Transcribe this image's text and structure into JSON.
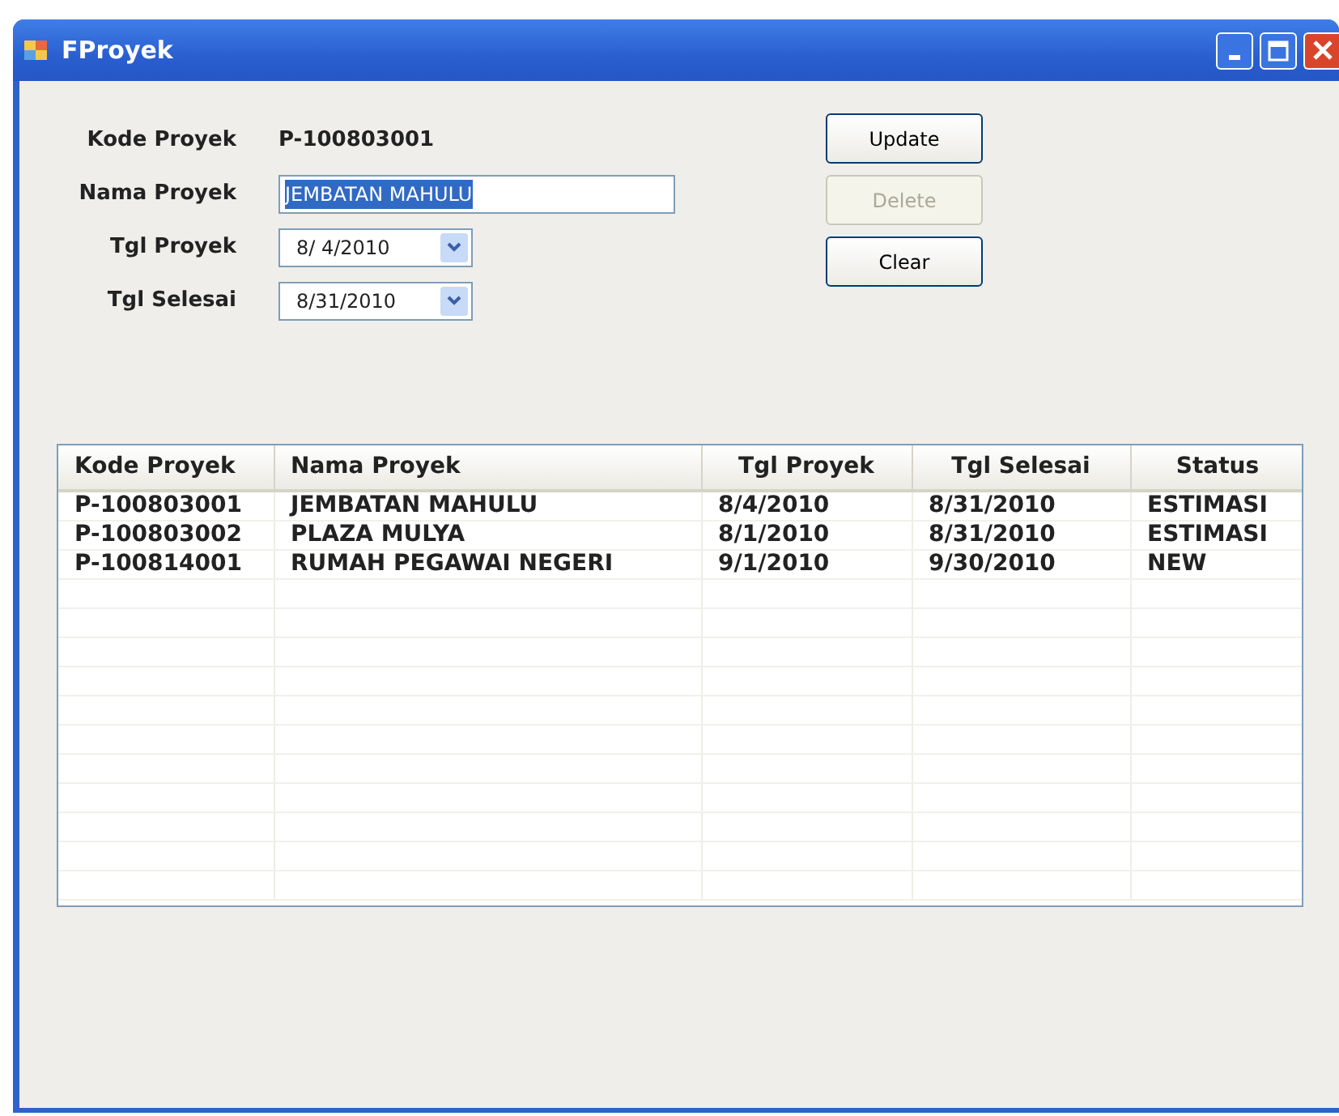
{
  "window": {
    "title": "FProyek"
  },
  "fields": [
    {
      "label": "Kode Proyek",
      "kind": "text",
      "value": "P-100803001",
      "highlighted": false
    },
    {
      "label": "Nama Proyek",
      "kind": "input",
      "value": "JEMBATAN MAHULU",
      "highlighted": true
    },
    {
      "label": "Tgl Proyek",
      "kind": "date",
      "value": "8/ 4/2010",
      "highlighted": false
    },
    {
      "label": "Tgl Selesai",
      "kind": "date",
      "value": "8/31/2010",
      "highlighted": false
    }
  ],
  "buttons": [
    {
      "label": "Update",
      "disabled": false
    },
    {
      "label": "Delete",
      "disabled": true
    },
    {
      "label": "Clear",
      "disabled": false
    }
  ],
  "table": {
    "columns": [
      "Kode Proyek",
      "Nama Proyek",
      "Tgl Proyek",
      "Tgl Selesai",
      "Status"
    ],
    "rows": [
      [
        "P-100803001",
        "JEMBATAN MAHULU",
        "8/4/2010",
        "8/31/2010",
        "ESTIMASI"
      ],
      [
        "P-100803002",
        "PLAZA MULYA",
        "8/1/2010",
        "8/31/2010",
        "ESTIMASI"
      ],
      [
        "P-100814001",
        "RUMAH PEGAWAI NEGERI",
        "9/1/2010",
        "9/30/2010",
        "NEW"
      ]
    ]
  }
}
